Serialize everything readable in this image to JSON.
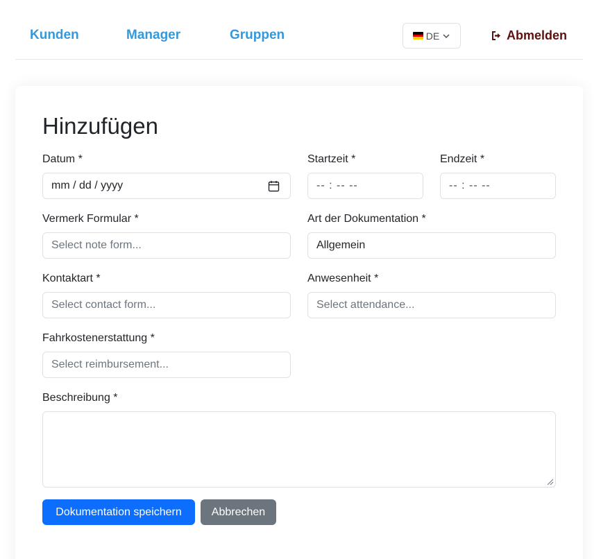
{
  "nav": {
    "links": [
      "Kunden",
      "Manager",
      "Gruppen"
    ],
    "language": "DE",
    "logout_label": "Abmelden",
    "flag_colors": [
      "#000000",
      "#dd0000",
      "#ffce00"
    ]
  },
  "form": {
    "title": "Hinzufügen",
    "date": {
      "label": "Datum *",
      "placeholder": "mm / dd / yyyy"
    },
    "start": {
      "label": "Startzeit *",
      "placeholder": "-- : --  --"
    },
    "end": {
      "label": "Endzeit *",
      "placeholder": "-- : --  --"
    },
    "note_form": {
      "label": "Vermerk Formular *",
      "placeholder": "Select note form..."
    },
    "doc_type": {
      "label": "Art der Dokumentation *",
      "value": "Allgemein"
    },
    "contact": {
      "label": "Kontaktart *",
      "placeholder": "Select contact form..."
    },
    "attendance": {
      "label": "Anwesenheit *",
      "placeholder": "Select attendance..."
    },
    "reimbursement": {
      "label": "Fahrkostenerstattung *",
      "placeholder": "Select reimbursement..."
    },
    "description": {
      "label": "Beschreibung *",
      "value": ""
    },
    "save_label": "Dokumentation speichern",
    "cancel_label": "Abbrechen"
  },
  "colors": {
    "primary": "#0d6efd",
    "secondary": "#6c757d",
    "nav_link": "#3498db",
    "logout": "#5c1010"
  }
}
